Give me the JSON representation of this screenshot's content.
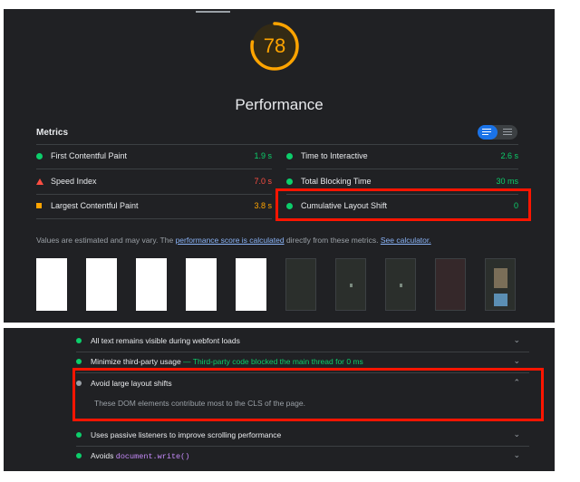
{
  "score": {
    "value": "78",
    "title": "Performance",
    "fraction": 0.78,
    "color": "#ffa400"
  },
  "metrics": {
    "heading": "Metrics",
    "items": [
      {
        "label": "First Contentful Paint",
        "value": "1.9 s",
        "icon": "pass-circle-icon",
        "color": "#0cce6b"
      },
      {
        "label": "Time to Interactive",
        "value": "2.6 s",
        "icon": "pass-circle-icon",
        "color": "#0cce6b"
      },
      {
        "label": "Speed Index",
        "value": "7.0 s",
        "icon": "fail-triangle-icon",
        "color": "#ff4e42"
      },
      {
        "label": "Total Blocking Time",
        "value": "30 ms",
        "icon": "pass-circle-icon",
        "color": "#0cce6b"
      },
      {
        "label": "Largest Contentful Paint",
        "value": "3.8 s",
        "icon": "average-square-icon",
        "color": "#ffa400"
      },
      {
        "label": "Cumulative Layout Shift",
        "value": "0",
        "icon": "pass-circle-icon",
        "color": "#0cce6b"
      }
    ],
    "note_pre": "Values are estimated and may vary. The ",
    "note_link1": "performance score is calculated",
    "note_mid": " directly from these metrics. ",
    "note_link2": "See calculator."
  },
  "audits": [
    {
      "label": "All text remains visible during webfont loads",
      "icon": "pass-circle-icon"
    },
    {
      "label": "Minimize third-party usage",
      "extra": " — Third-party code blocked the main thread for 0 ms",
      "icon": "pass-circle-icon"
    },
    {
      "label": "Avoid large layout shifts",
      "icon": "info-circle-icon",
      "detail": "These DOM elements contribute most to the CLS of the page."
    },
    {
      "label": "Uses passive listeners to improve scrolling performance",
      "icon": "pass-circle-icon"
    },
    {
      "label": "Avoids ",
      "code": "document.write()",
      "icon": "pass-circle-icon"
    }
  ],
  "colors": {
    "pass": "#0cce6b",
    "average": "#ffa400",
    "fail": "#ff4e42",
    "link": "#8ab4f8",
    "highlight": "#ff1500"
  }
}
